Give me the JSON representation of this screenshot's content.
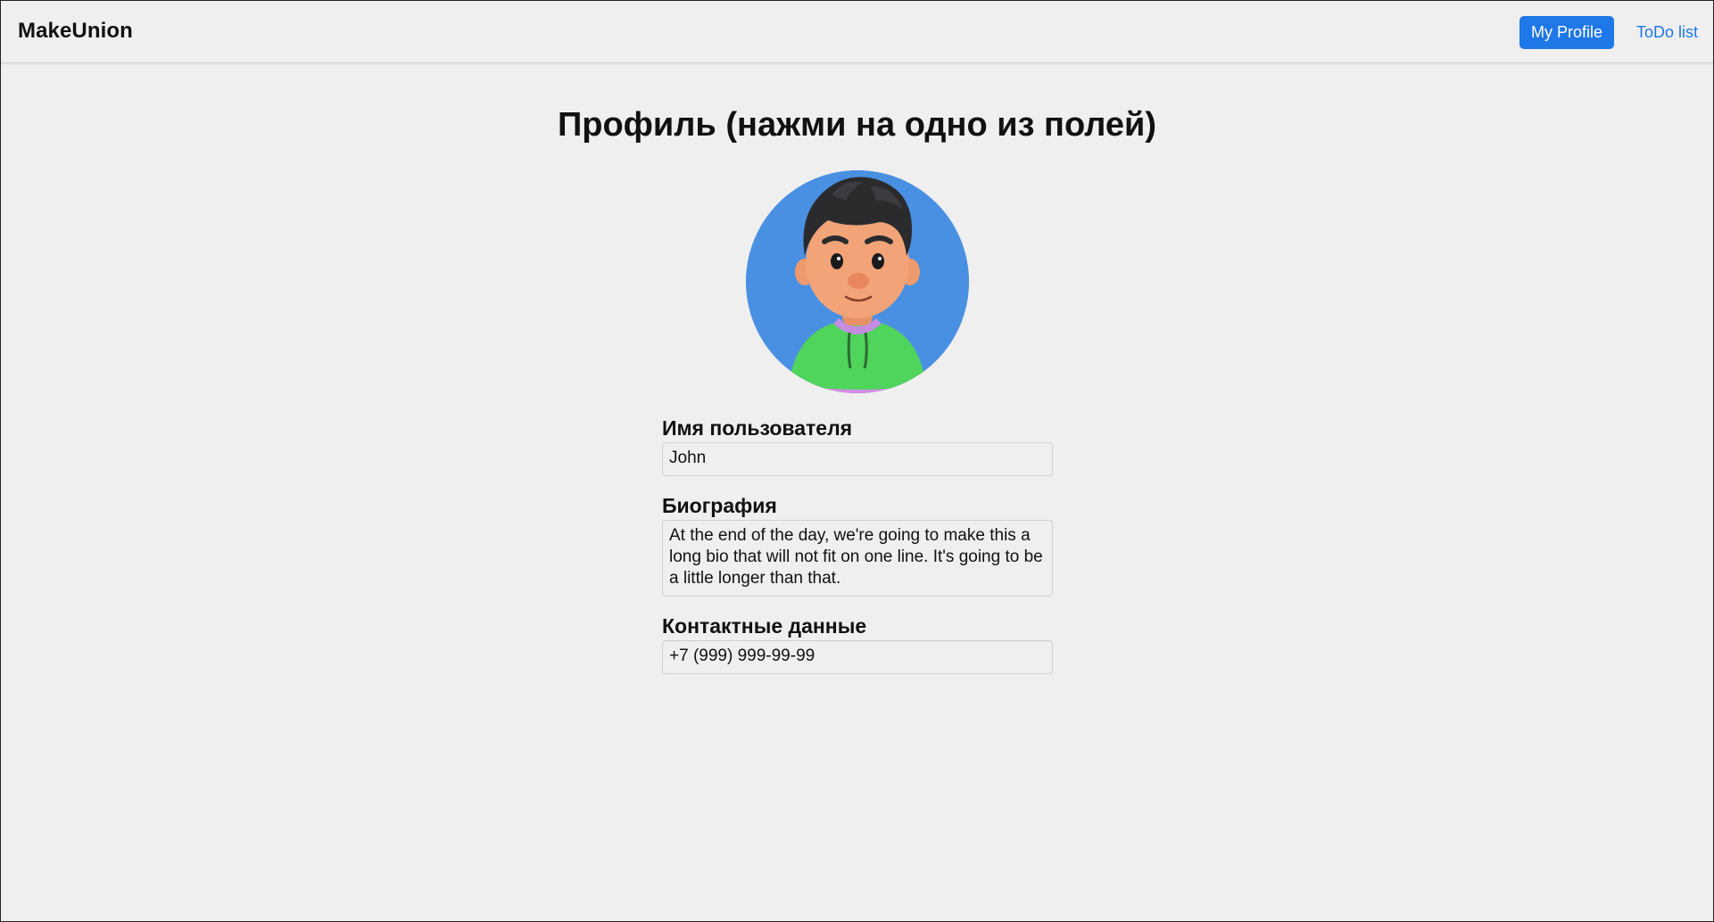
{
  "header": {
    "brand": "MakeUnion",
    "nav": {
      "my_profile": "My Profile",
      "todo_list": "ToDo list"
    }
  },
  "main": {
    "title": "Профиль (нажми на одно из полей)",
    "avatar_icon": "user-avatar-illustration",
    "fields": {
      "username": {
        "label": "Имя пользователя",
        "value": "John"
      },
      "bio": {
        "label": "Биография",
        "value": "At the end of the day, we're going to make this a long bio that will not fit on one line. It's going to be a little longer than that."
      },
      "contact": {
        "label": "Контактные данные",
        "value": "+7 (999) 999-99-99"
      }
    }
  },
  "colors": {
    "accent": "#1f78e8",
    "background": "#efefef",
    "avatar_bg": "#4a90e2"
  }
}
